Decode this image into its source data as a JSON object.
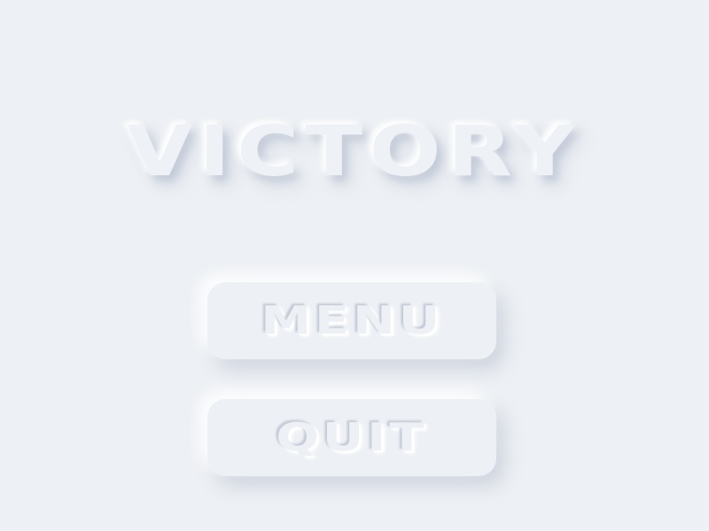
{
  "screen": {
    "title": "VICTORY"
  },
  "buttons": {
    "menu_label": "MENU",
    "quit_label": "QUIT"
  },
  "colors": {
    "background": "#edf0f4",
    "shadow": "#a8b2c4",
    "highlight": "#ffffff"
  }
}
